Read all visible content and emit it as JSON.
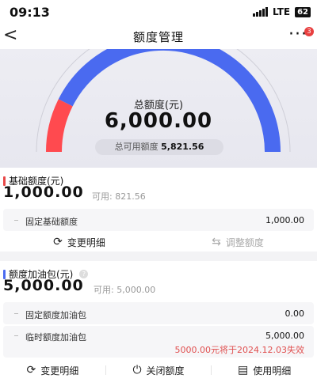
{
  "status": {
    "time": "09:13",
    "network": "LTE",
    "battery": "62"
  },
  "nav": {
    "title": "额度管理",
    "back_icon": "back-chevron-icon",
    "more_icon": "more-dots-icon",
    "badge": "3"
  },
  "hero": {
    "label": "总额度(元)",
    "total": "6,000.00",
    "available_label": "总可用额度",
    "available_value": "5,821.56",
    "used_fraction": 0.0297,
    "colors": {
      "used": "#ff4a4f",
      "remaining": "#4a6af0"
    }
  },
  "base": {
    "title": "基础额度(元)",
    "amount": "1,000.00",
    "available": "可用: 821.56",
    "marker_color": "#e84848",
    "row": {
      "label": "固定基础额度",
      "value": "1,000.00"
    },
    "actions": [
      {
        "label": "变更明细",
        "icon": "refresh-icon",
        "enabled": true
      },
      {
        "label": "调整额度",
        "icon": "adjust-sliders-icon",
        "enabled": false
      }
    ]
  },
  "booster": {
    "title": "额度加油包(元)",
    "amount": "5,000.00",
    "available": "可用: 5,000.00",
    "marker_color": "#4a6af0",
    "rows": [
      {
        "label": "固定额度加油包",
        "value": "0.00"
      },
      {
        "label": "临时额度加油包",
        "value": "5,000.00",
        "note": "5000.00元将于2024.12.03失效"
      }
    ],
    "actions": [
      {
        "label": "变更明细",
        "icon": "refresh-icon"
      },
      {
        "label": "关闭额度",
        "icon": "power-icon"
      },
      {
        "label": "使用明细",
        "icon": "document-icon"
      }
    ]
  }
}
